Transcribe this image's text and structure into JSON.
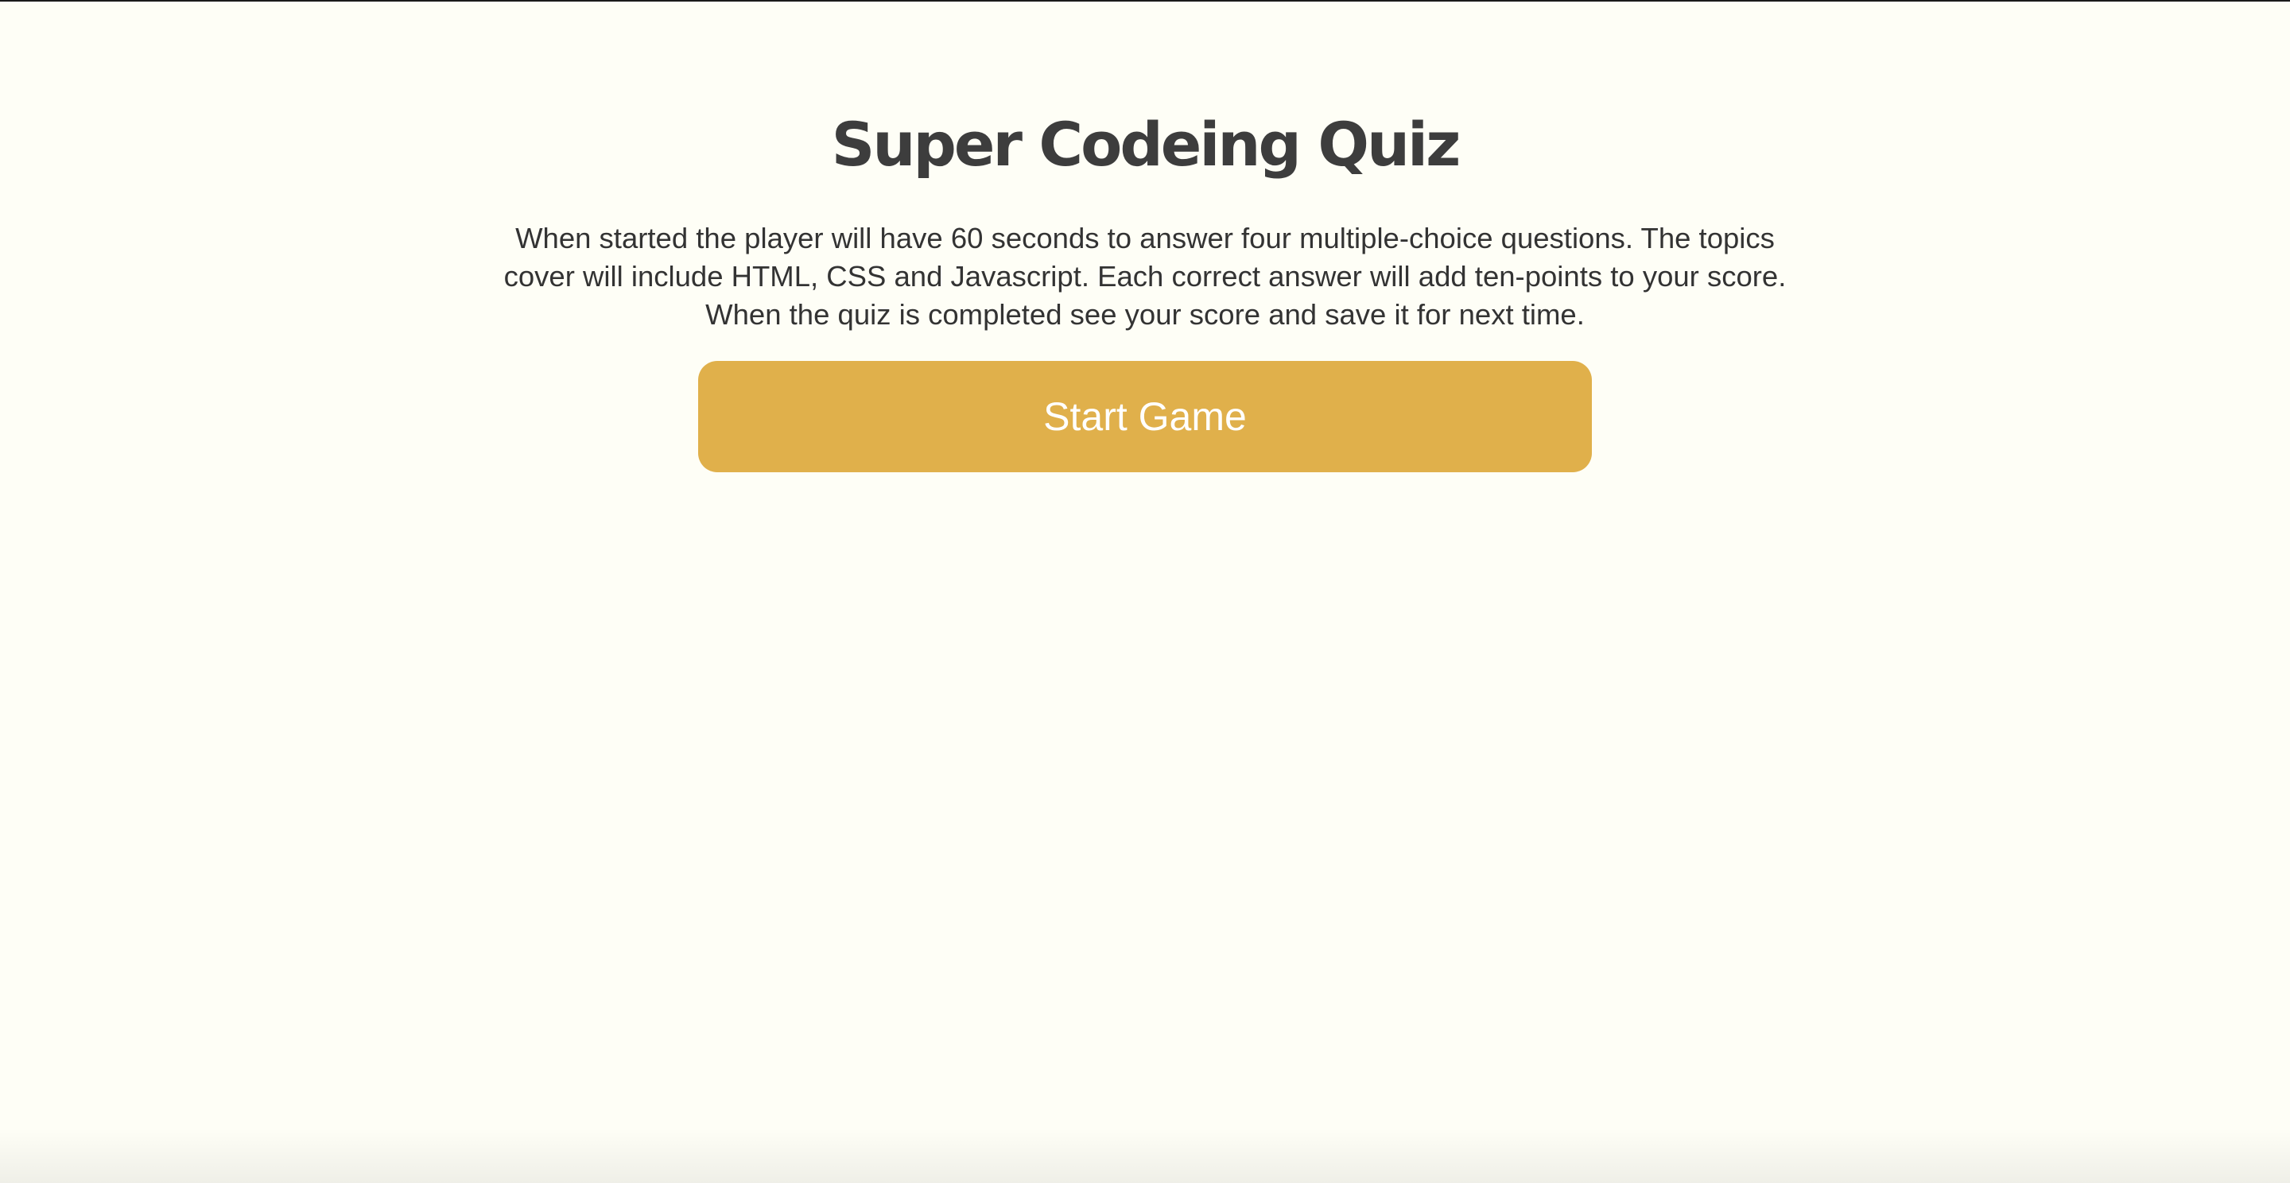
{
  "page": {
    "title": "Super Codeing Quiz",
    "description": "When started the player will have 60 seconds to answer four multiple-choice questions. The topics cover will include HTML, CSS and Javascript. Each correct answer will add ten-points to your score. When the quiz is completed see your score and save it for next time.",
    "start_button_label": "Start Game"
  },
  "colors": {
    "background": "#fefef6",
    "title_text": "#3d3d3d",
    "body_text": "#333333",
    "button_background": "#e0b04b",
    "button_text": "#ffffff"
  }
}
